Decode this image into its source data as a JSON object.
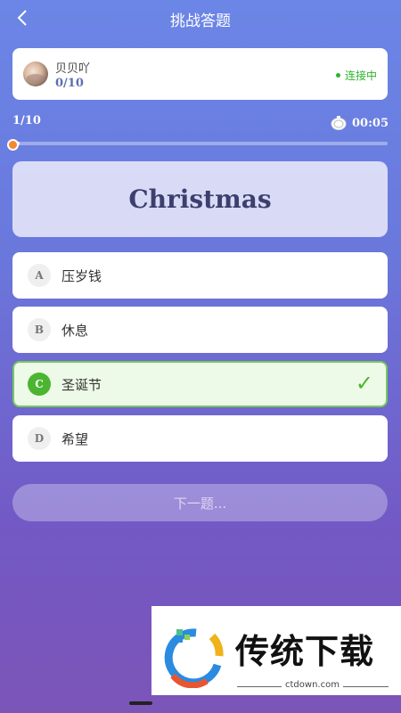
{
  "header": {
    "title": "挑战答题"
  },
  "user": {
    "name": "贝贝吖",
    "score": "0/10",
    "status": "连接中"
  },
  "progress": {
    "label": "1/10",
    "timer": "00:05",
    "fraction": 0.02
  },
  "question": {
    "word": "Christmas"
  },
  "options": [
    {
      "letter": "A",
      "text": "压岁钱"
    },
    {
      "letter": "B",
      "text": "休息"
    },
    {
      "letter": "C",
      "text": "圣诞节",
      "selected": true
    },
    {
      "letter": "D",
      "text": "希望"
    }
  ],
  "check_mark": "✓",
  "next_button": {
    "label": "下一题..."
  },
  "watermark": {
    "brand": "传统下载",
    "url": "ctdown.com"
  },
  "colors": {
    "accent": "#4bb531",
    "knob": "#f28a2e",
    "correct_border": "#76c85b"
  }
}
